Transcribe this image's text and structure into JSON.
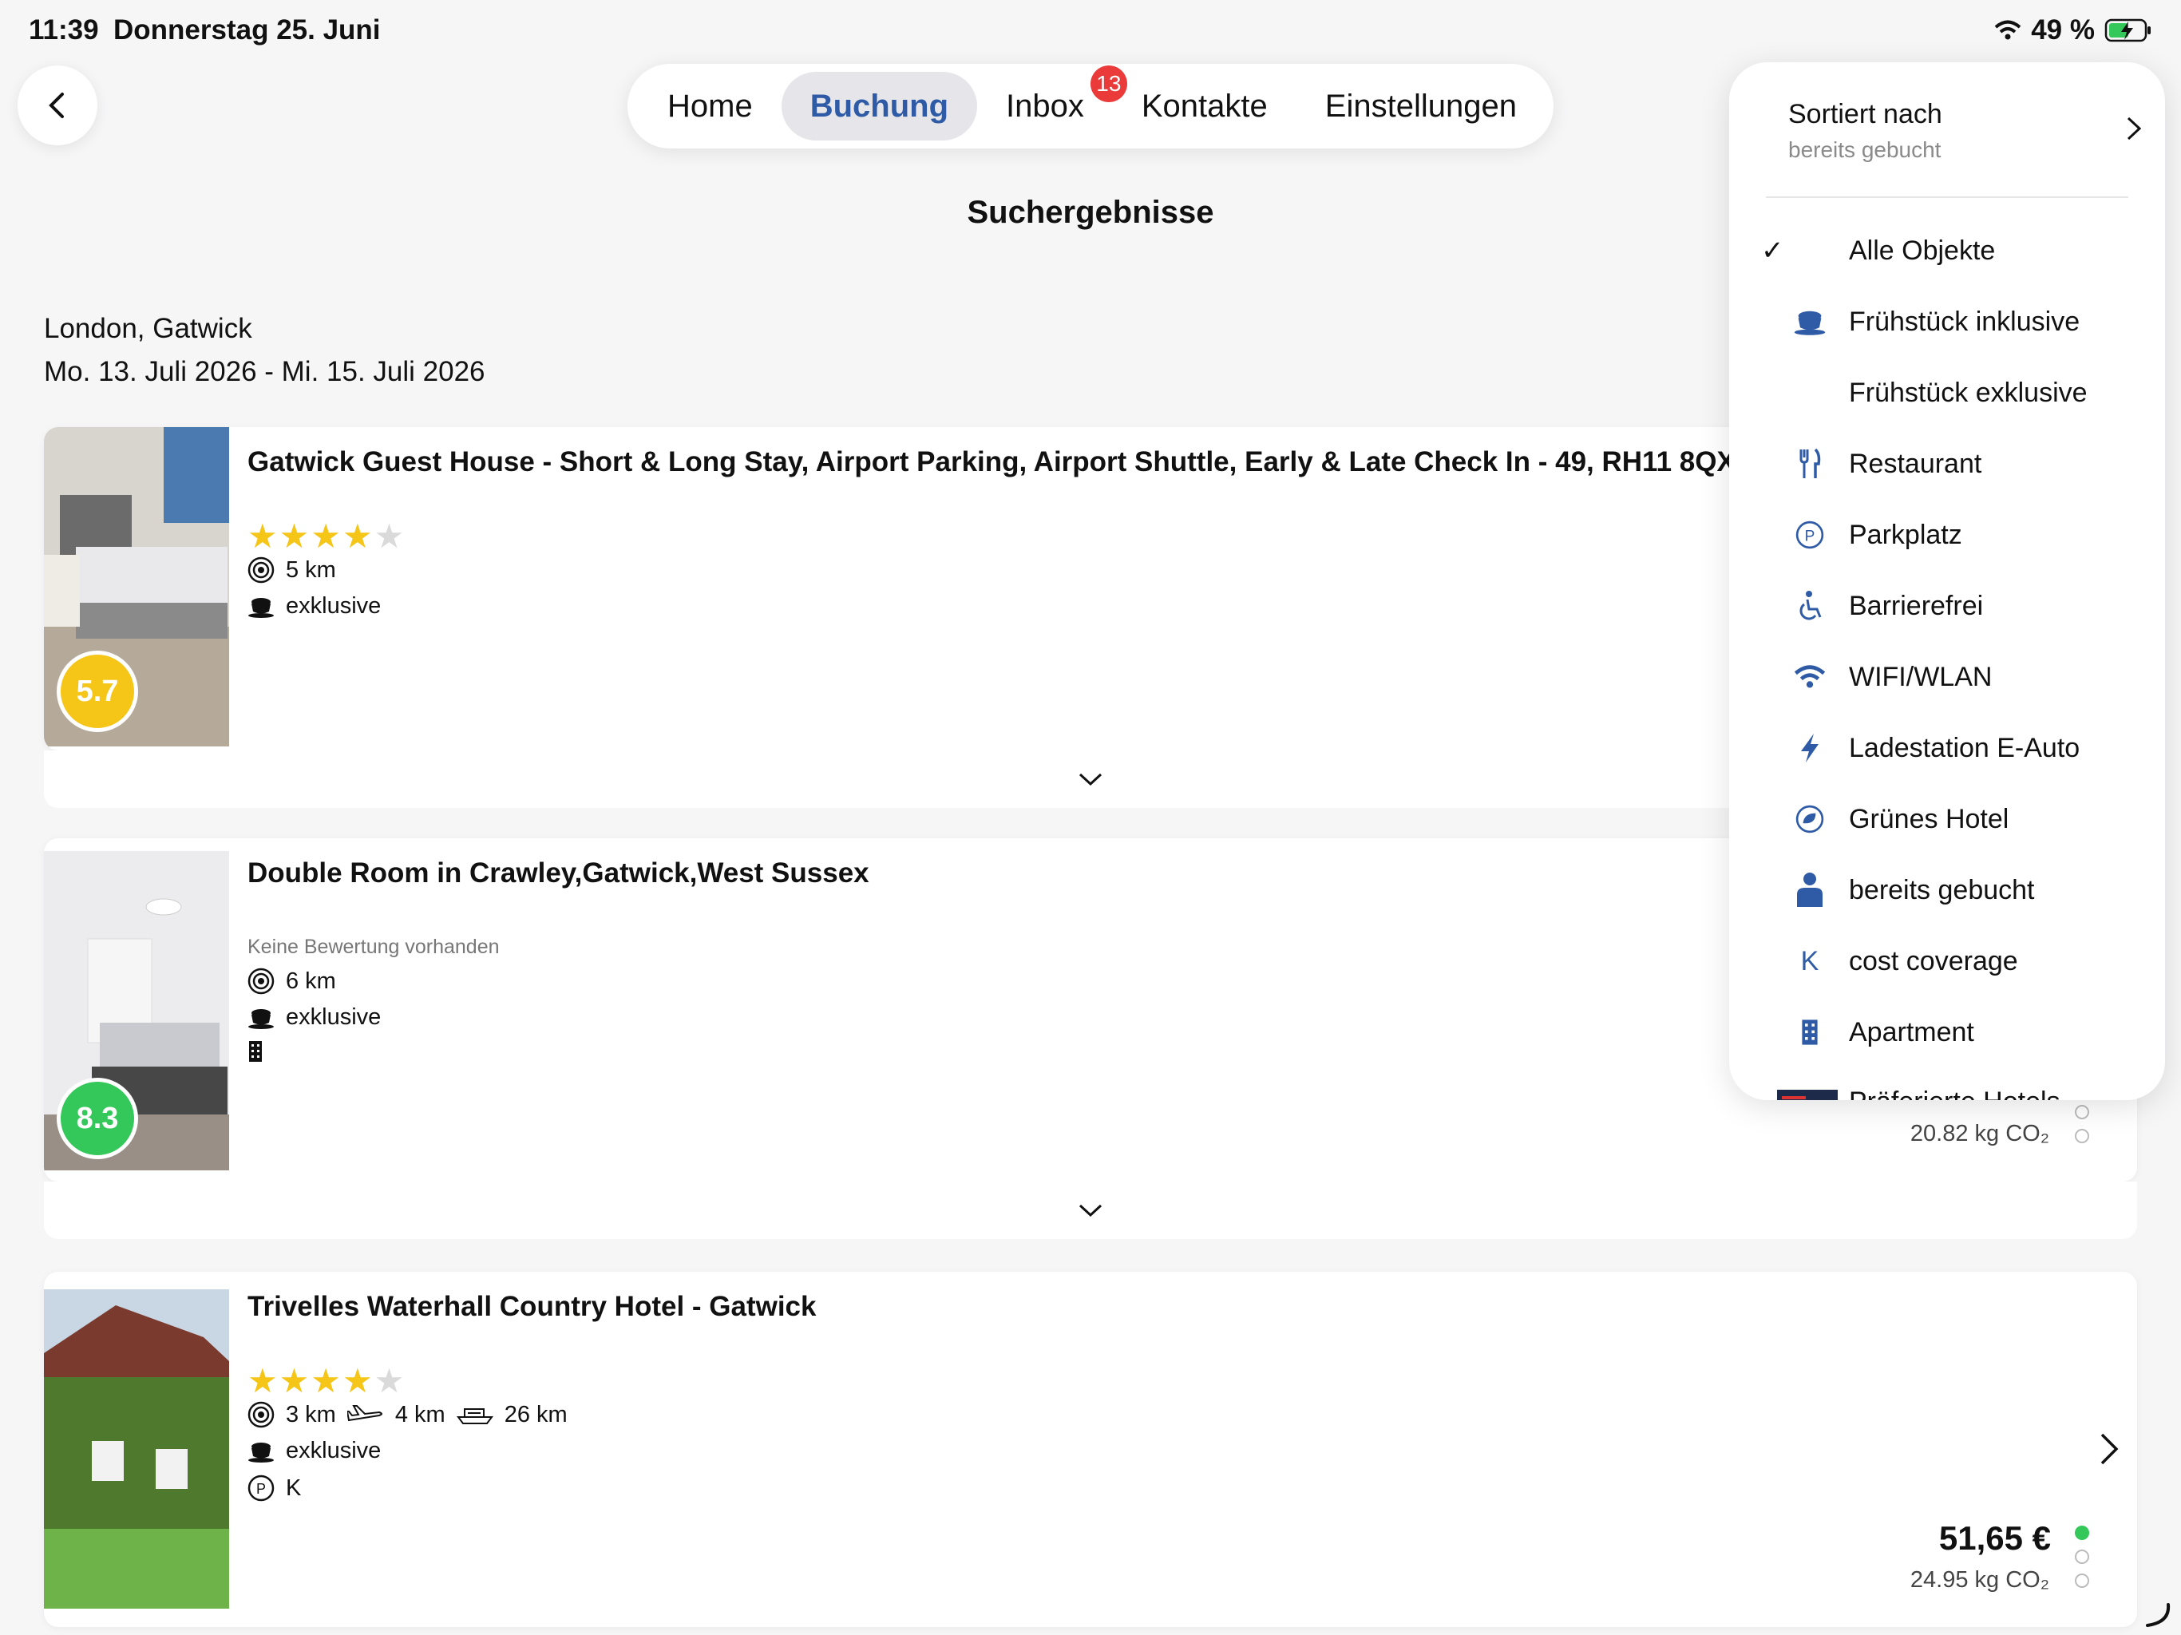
{
  "status": {
    "time": "11:39",
    "date": "Donnerstag 25. Juni",
    "battery": "49 %"
  },
  "nav": {
    "tabs": [
      "Home",
      "Buchung",
      "Inbox",
      "Kontakte",
      "Einstellungen"
    ],
    "active": "Buchung",
    "inbox_badge": "13"
  },
  "page_title": "Suchergebnisse",
  "search": {
    "location": "London, Gatwick",
    "dates": "Mo. 13. Juli 2026 - Mi. 15. Juli 2026"
  },
  "results": [
    {
      "title": "Gatwick Guest House - Short & Long Stay, Airport Parking, Airport Shuttle, Early & Late Check In - 49, RH11 8QX",
      "stars": 4,
      "distance": "5 km",
      "breakfast": "exklusive",
      "score": "5.7",
      "score_color": "#f5c518"
    },
    {
      "title": "Double Room in Crawley,Gatwick,West Sussex",
      "no_rating": "Keine Bewertung vorhanden",
      "distance": "6 km",
      "breakfast": "exklusive",
      "score": "8.3",
      "score_color": "#34c759",
      "co2": "20.82 kg CO₂"
    },
    {
      "title": "Trivelles Waterhall Country Hotel - Gatwick",
      "stars": 4,
      "distance": "3 km",
      "airport": "4 km",
      "ship": "26 km",
      "breakfast": "exklusive",
      "parking": "K",
      "price": "51,65 €",
      "co2": "24.95 kg CO₂"
    }
  ],
  "filter_menu": {
    "sort_label": "Sortiert nach",
    "sort_value": "bereits gebucht",
    "items": [
      {
        "label": "Alle Objekte",
        "icon": "checkmark",
        "checked": true
      },
      {
        "label": "Frühstück inklusive",
        "icon": "coffee-cup-icon"
      },
      {
        "label": "Frühstück exklusive",
        "icon": ""
      },
      {
        "label": "Restaurant",
        "icon": "fork-knife-icon"
      },
      {
        "label": "Parkplatz",
        "icon": "parking-icon"
      },
      {
        "label": "Barrierefrei",
        "icon": "wheelchair-icon"
      },
      {
        "label": "WIFI/WLAN",
        "icon": "wifi-icon"
      },
      {
        "label": "Ladestation E-Auto",
        "icon": "bolt-icon"
      },
      {
        "label": "Grünes Hotel",
        "icon": "leaf-icon"
      },
      {
        "label": "bereits gebucht",
        "icon": "person-icon"
      },
      {
        "label": "cost coverage",
        "icon": "k-icon"
      },
      {
        "label": "Apartment",
        "icon": "building-icon"
      },
      {
        "label": "Präferierte Hotels",
        "icon": "preferred-hotels-icon"
      }
    ]
  },
  "colors": {
    "accent": "#2f5ba6",
    "badge": "#ea3a3a",
    "star": "#f5c518",
    "green": "#34c759"
  }
}
